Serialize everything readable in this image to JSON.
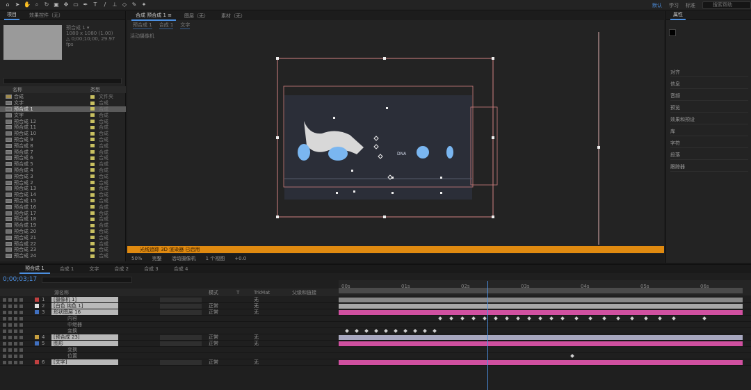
{
  "toolbar": {
    "tools": [
      "home-icon",
      "arrow-icon",
      "hand-icon",
      "zoom-icon",
      "rotate-icon",
      "camera-icon",
      "pan-icon",
      "mask-icon",
      "pen-icon",
      "text-icon",
      "brush-icon",
      "stamp-icon",
      "eraser-icon",
      "roto-icon",
      "puppet-icon"
    ],
    "workspaces": [
      "默认",
      "学习",
      "标准"
    ],
    "workspace_active": "默认",
    "search_placeholder": "搜索帮助"
  },
  "project": {
    "tabs": [
      "项目",
      "效果控件（无）"
    ],
    "active_tab": "项目",
    "thumb_info": [
      "预合成 1 ▾",
      "1080 x 1080 (1.00)",
      "△ 0;00;10;00, 29.97 fps"
    ],
    "columns": [
      "名称",
      "类型"
    ],
    "rows": [
      {
        "name": "合成",
        "type": "文件夹",
        "folder": true,
        "color": "#c8c060"
      },
      {
        "name": "文字",
        "type": "合成",
        "folder": false,
        "color": "#c8c060"
      },
      {
        "name": "预合成 1",
        "type": "合成",
        "folder": false,
        "color": "#c8c060",
        "selected": true
      },
      {
        "name": "文字",
        "type": "合成",
        "folder": false,
        "color": "#c8c060"
      },
      {
        "name": "预合成 12",
        "type": "合成",
        "folder": false,
        "color": "#c8c060"
      },
      {
        "name": "预合成 11",
        "type": "合成",
        "folder": false,
        "color": "#c8c060"
      },
      {
        "name": "预合成 10",
        "type": "合成",
        "folder": false,
        "color": "#c8c060"
      },
      {
        "name": "预合成 9",
        "type": "合成",
        "folder": false,
        "color": "#c8c060"
      },
      {
        "name": "预合成 8",
        "type": "合成",
        "folder": false,
        "color": "#c8c060"
      },
      {
        "name": "预合成 7",
        "type": "合成",
        "folder": false,
        "color": "#c8c060"
      },
      {
        "name": "预合成 6",
        "type": "合成",
        "folder": false,
        "color": "#c8c060"
      },
      {
        "name": "预合成 5",
        "type": "合成",
        "folder": false,
        "color": "#c8c060"
      },
      {
        "name": "预合成 4",
        "type": "合成",
        "folder": false,
        "color": "#c8c060"
      },
      {
        "name": "预合成 3",
        "type": "合成",
        "folder": false,
        "color": "#c8c060"
      },
      {
        "name": "预合成 2",
        "type": "合成",
        "folder": false,
        "color": "#c8c060"
      },
      {
        "name": "预合成 13",
        "type": "合成",
        "folder": false,
        "color": "#c8c060"
      },
      {
        "name": "预合成 14",
        "type": "合成",
        "folder": false,
        "color": "#c8c060"
      },
      {
        "name": "预合成 15",
        "type": "合成",
        "folder": false,
        "color": "#c8c060"
      },
      {
        "name": "预合成 16",
        "type": "合成",
        "folder": false,
        "color": "#c8c060"
      },
      {
        "name": "预合成 17",
        "type": "合成",
        "folder": false,
        "color": "#c8c060"
      },
      {
        "name": "预合成 18",
        "type": "合成",
        "folder": false,
        "color": "#c8c060"
      },
      {
        "name": "预合成 19",
        "type": "合成",
        "folder": false,
        "color": "#c8c060"
      },
      {
        "name": "预合成 20",
        "type": "合成",
        "folder": false,
        "color": "#c8c060"
      },
      {
        "name": "预合成 21",
        "type": "合成",
        "folder": false,
        "color": "#c8c060"
      },
      {
        "name": "预合成 22",
        "type": "合成",
        "folder": false,
        "color": "#c8c060"
      },
      {
        "name": "预合成 23",
        "type": "合成",
        "folder": false,
        "color": "#c8c060"
      },
      {
        "name": "预合成 24",
        "type": "合成",
        "folder": false,
        "color": "#c8c060"
      }
    ]
  },
  "composition": {
    "tabs": [
      "合成 预合成 1 ≡",
      "图层（无）",
      "素材（无）"
    ],
    "active_tab": "合成 预合成 1 ≡",
    "breadcrumbs": [
      "预合成 1",
      "合成 1",
      "文字"
    ],
    "viewport_label": "活动摄像机",
    "canvas_text": "DNA",
    "orange_bar": "光线追踪 3D 渲染器 已启用",
    "controls": [
      "50%",
      "完整",
      "活动摄像机",
      "1 个视图",
      "+0.0"
    ]
  },
  "props_panel": {
    "title": "属性",
    "items": [
      "对齐",
      "信息",
      "音频",
      "预览",
      "效果和预设",
      "库",
      "字符",
      "段落",
      "跟踪器"
    ]
  },
  "timeline": {
    "tabs": [
      "预合成 1",
      "合成 1",
      "文字",
      "合成 2",
      "合成 3",
      "合成 4"
    ],
    "active_tab": "预合成 1",
    "timecode": "0;00;03;17",
    "columns": [
      "源名称",
      "模式",
      "T",
      "TrkMat",
      "父级和链接"
    ],
    "ticks": [
      "00s",
      "01s",
      "02s",
      "03s",
      "04s",
      "05s",
      "06s",
      "07s"
    ],
    "layers": [
      {
        "num": "1",
        "name": "[摄像机 1]",
        "color": "#c04040",
        "mode": "",
        "par": "无",
        "sub": false,
        "bar": "#888888"
      },
      {
        "num": "2",
        "name": "[白色 纯色 1]",
        "color": "#e0e0e0",
        "mode": "正常",
        "par": "无",
        "sub": false,
        "bar": "#a8a8a8"
      },
      {
        "num": "3",
        "name": "形状图层 16",
        "color": "#4070c0",
        "mode": "正常",
        "par": "无",
        "sub": false,
        "bar": "#d050a0"
      },
      {
        "num": "",
        "name": "内容",
        "color": "",
        "mode": "",
        "par": "",
        "sub": true,
        "bar": ""
      },
      {
        "num": "",
        "name": "中继器",
        "color": "",
        "mode": "",
        "par": "",
        "sub": true,
        "bar": ""
      },
      {
        "num": "",
        "name": "变换",
        "color": "",
        "mode": "",
        "par": "",
        "sub": true,
        "bar": ""
      },
      {
        "num": "4",
        "name": "[预合成 23]",
        "color": "#c8a040",
        "mode": "正常",
        "par": "无",
        "sub": false,
        "bar": "#a8a8c0"
      },
      {
        "num": "5",
        "name": "图形",
        "color": "#4070c0",
        "mode": "正常",
        "par": "无",
        "sub": false,
        "bar": "#d050a0"
      },
      {
        "num": "",
        "name": "变换",
        "color": "",
        "mode": "",
        "par": "",
        "sub": true,
        "bar": ""
      },
      {
        "num": "",
        "name": "位置",
        "color": "",
        "mode": "",
        "par": "",
        "sub": true,
        "bar": ""
      },
      {
        "num": "6",
        "name": "[文字]",
        "color": "#c04040",
        "mode": "正常",
        "par": "无",
        "sub": false,
        "bar": "#d050a0"
      }
    ],
    "playhead_fraction": 0.36,
    "colors": {
      "accent": "#4c8fe0",
      "bar_pink": "#d050a0",
      "orange": "#e08a10"
    }
  }
}
